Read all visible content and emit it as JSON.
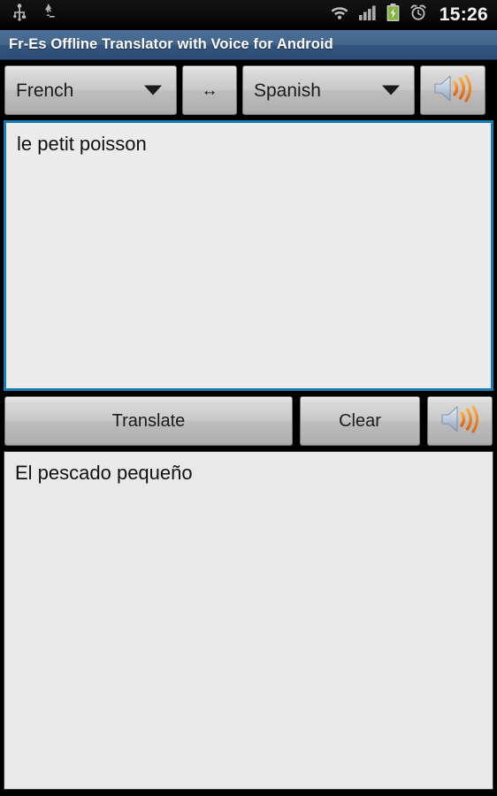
{
  "status_bar": {
    "time": "15:26",
    "left_icons": [
      {
        "name": "usb-icon",
        "label": "USB connected"
      },
      {
        "name": "sync-recycle-icon",
        "label": "Sync / recycle"
      }
    ],
    "right_icons": [
      {
        "name": "wifi-icon",
        "label": "Wi-Fi signal"
      },
      {
        "name": "cellular-signal-icon",
        "label": "Cellular signal"
      },
      {
        "name": "battery-charging-icon",
        "label": "Battery charging"
      },
      {
        "name": "alarm-clock-icon",
        "label": "Alarm set"
      }
    ],
    "colors": {
      "background": "#0b0b0b",
      "text": "#f2f2f2",
      "battery_green": "#8cc63f"
    }
  },
  "title_bar": {
    "title": "Fr-Es Offline Translator with Voice for Android",
    "colors": {
      "background_top": "#4e7099",
      "background_bottom": "#2d4d76",
      "text": "#ffffff"
    }
  },
  "language_row": {
    "source_language": "French",
    "target_language": "Spanish",
    "swap_glyph": "↔",
    "swap_label": "Swap languages",
    "speak_source_label": "Speak source text",
    "caret_icon": "chevron-down-icon"
  },
  "input_area": {
    "value": "le petit poisson",
    "placeholder": "",
    "colors": {
      "background": "#ececec",
      "focus_border": "#1a7cb5",
      "text": "#111111"
    }
  },
  "action_row": {
    "translate_label": "Translate",
    "clear_label": "Clear",
    "speak_result_label": "Speak translation"
  },
  "output_area": {
    "value": "El pescado pequeño",
    "colors": {
      "background": "#e9e9e9",
      "border": "#3a3a3a",
      "text": "#111111"
    }
  },
  "theme": {
    "screen_background": "#000000",
    "button_face_light": "#e8e8e8",
    "button_face_dark": "#a6a6a6",
    "button_border": "#767676",
    "speaker_cone": "#b9c6d4",
    "speaker_wave": "#f08a22"
  }
}
